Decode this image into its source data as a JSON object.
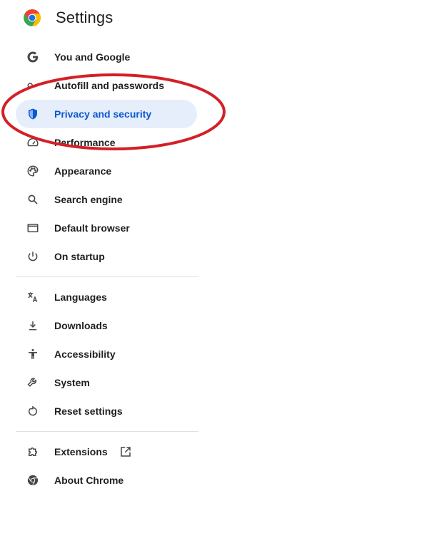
{
  "header": {
    "title": "Settings"
  },
  "nav": {
    "group1": [
      {
        "label": "You and Google",
        "icon": "google-g-icon"
      },
      {
        "label": "Autofill and passwords",
        "icon": "key-icon"
      },
      {
        "label": "Privacy and security",
        "icon": "shield-icon",
        "active": true
      },
      {
        "label": "Performance",
        "icon": "speedometer-icon"
      },
      {
        "label": "Appearance",
        "icon": "palette-icon"
      },
      {
        "label": "Search engine",
        "icon": "search-icon"
      },
      {
        "label": "Default browser",
        "icon": "browser-window-icon"
      },
      {
        "label": "On startup",
        "icon": "power-icon"
      }
    ],
    "group2": [
      {
        "label": "Languages",
        "icon": "translate-icon"
      },
      {
        "label": "Downloads",
        "icon": "download-icon"
      },
      {
        "label": "Accessibility",
        "icon": "accessibility-icon"
      },
      {
        "label": "System",
        "icon": "wrench-icon"
      },
      {
        "label": "Reset settings",
        "icon": "reset-icon"
      }
    ],
    "group3": [
      {
        "label": "Extensions",
        "icon": "puzzle-icon",
        "external": "open-in-new-icon"
      },
      {
        "label": "About Chrome",
        "icon": "chrome-icon"
      }
    ]
  },
  "colors": {
    "active_bg": "#e6eefb",
    "active_text": "#0b57d0",
    "annotation_red": "#d32027"
  }
}
